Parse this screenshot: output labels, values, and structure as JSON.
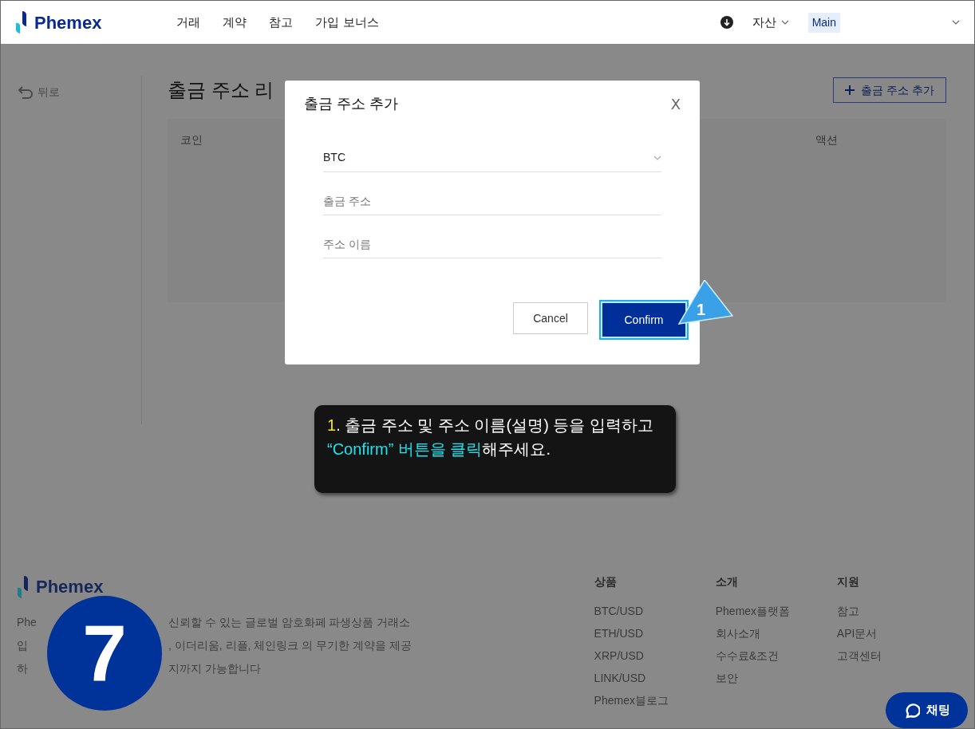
{
  "header": {
    "logo": "Phemex",
    "nav": [
      "거래",
      "계약",
      "참고",
      "가입 보너스"
    ],
    "assets": "자산",
    "account": "Main"
  },
  "sidebar": {
    "back": "뒤로"
  },
  "page": {
    "title": "출금 주소 리",
    "add_button": "출금 주소 추가",
    "columns": [
      "코인",
      "액션"
    ]
  },
  "modal": {
    "title": "출금 주소 추가",
    "close": "X",
    "fields": [
      {
        "kind": "select",
        "value": "BTC"
      },
      {
        "kind": "input",
        "placeholder": "출금 주소"
      },
      {
        "kind": "input",
        "placeholder": "주소 이름"
      }
    ],
    "cancel": "Cancel",
    "confirm": "Confirm"
  },
  "callout": {
    "marker": "1"
  },
  "tooltip": {
    "lines": [
      [
        {
          "kind": "number",
          "text": "1"
        },
        {
          "kind": "plain",
          "text": ". 출금 주소 및 주소 이름(설명) 등을 입력하고"
        }
      ],
      [
        {
          "kind": "highlight",
          "text": "“Confirm” 버튼을 클릭"
        },
        {
          "kind": "plain",
          "text": "해주세요."
        }
      ]
    ]
  },
  "step_badge": "7",
  "footer": {
    "logo": "Phemex",
    "description": [
      [
        "Phe",
        "신뢰할 수 있는 글로벌 암호화페 파생상품 거래소"
      ],
      [
        "입",
        ", 이더리움, 리플, 체인링크 의 무기한 계약을 제공"
      ],
      [
        "하",
        "지까지 가능합니다"
      ]
    ],
    "columns": [
      {
        "title": "상품",
        "links": [
          "BTC/USD",
          "ETH/USD",
          "XRP/USD",
          "LINK/USD",
          "Phemex블로그"
        ]
      },
      {
        "title": "소개",
        "links": [
          "Phemex플랫폼",
          "회사소개",
          "수수료&조건",
          "보안"
        ]
      },
      {
        "title": "지원",
        "links": [
          "참고",
          "API문서",
          "고객센터"
        ]
      }
    ]
  },
  "chat_button": "채팅"
}
